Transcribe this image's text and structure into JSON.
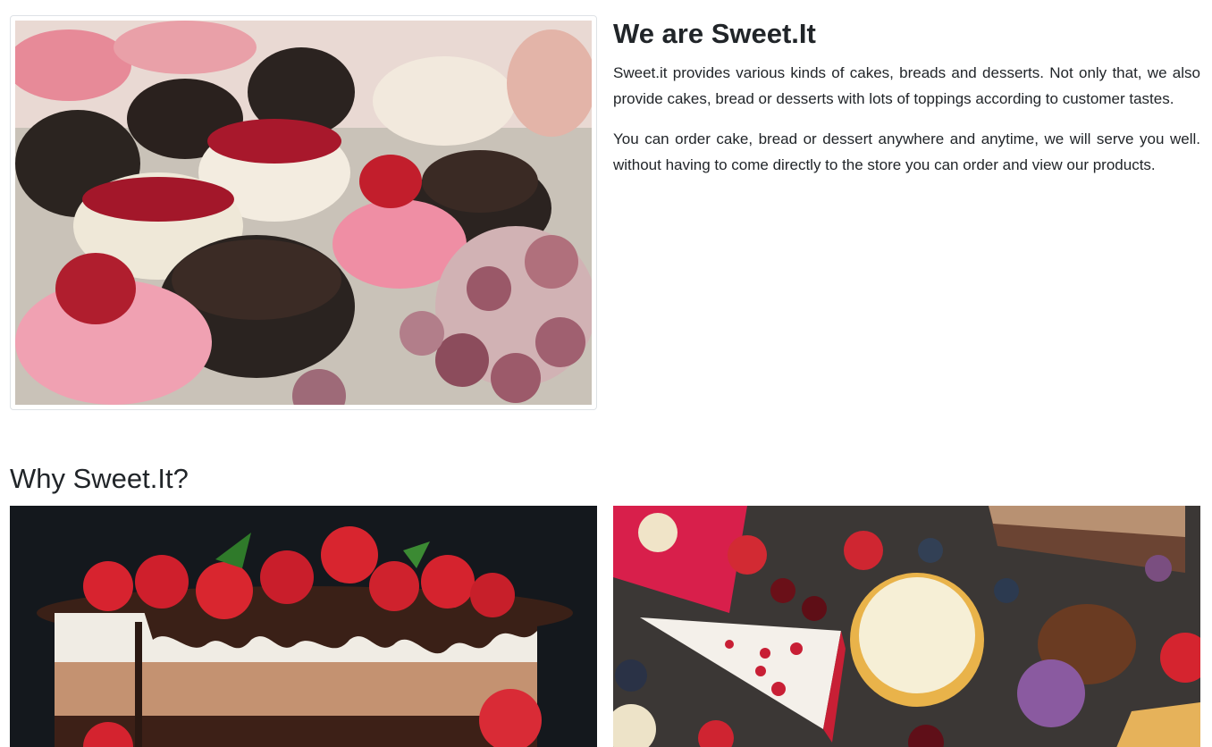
{
  "about": {
    "title": "We are Sweet.It",
    "paragraphs": [
      "Sweet.it provides various kinds of cakes, breads and desserts. Not only that, we also provide cakes, bread or desserts with lots of toppings according to customer tastes.",
      "You can order cake, bread or dessert anywhere and anytime, we will serve you well. without having to come directly to the store you can order and view our products."
    ]
  },
  "why": {
    "title": "Why Sweet.It?"
  },
  "images": {
    "about": "cupcakes-and-mini-cakes-photo",
    "why_left": "strawberry-chocolate-mousse-cake-photo",
    "why_right": "assorted-dessert-slices-photo"
  },
  "colors": {
    "text": "#212529",
    "border": "#dee2e6"
  }
}
